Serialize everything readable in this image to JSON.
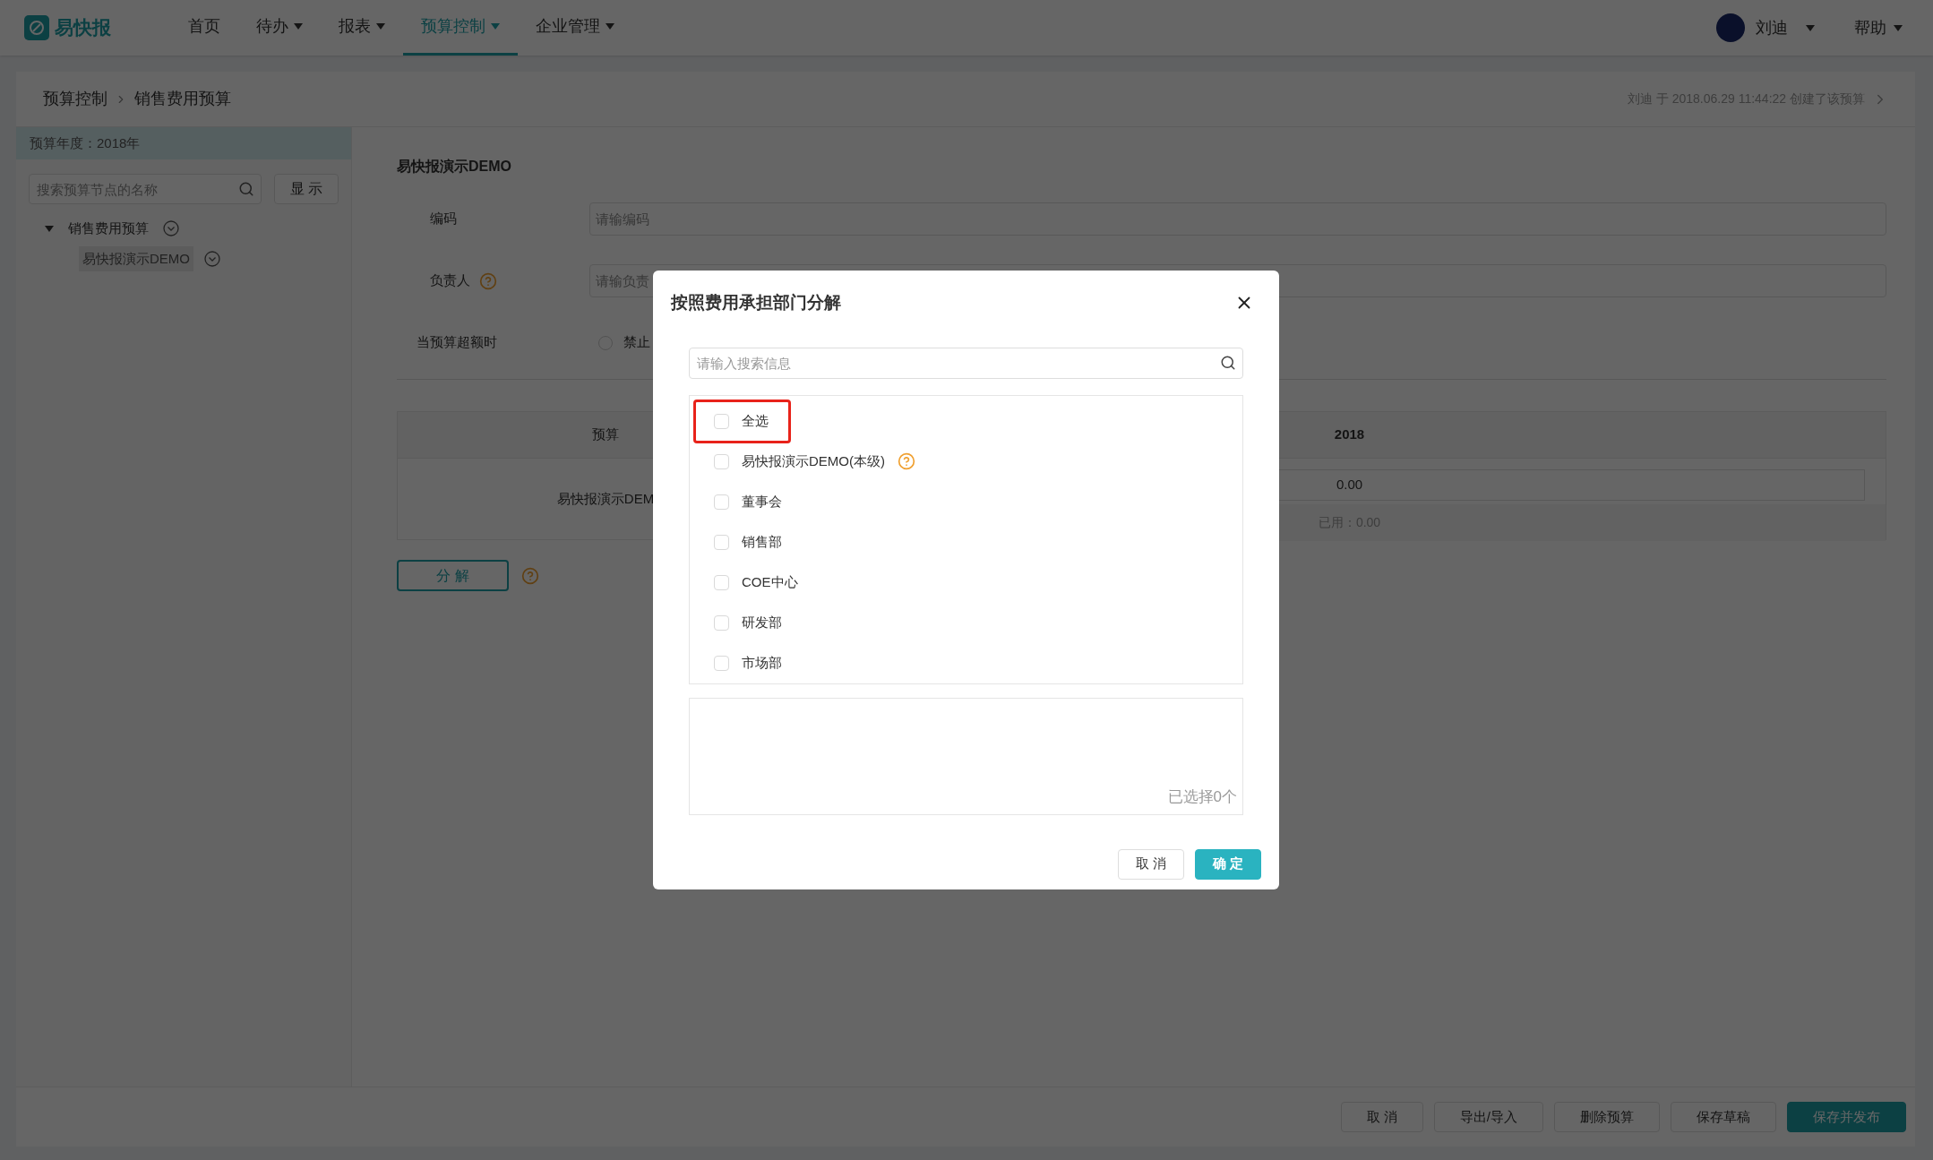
{
  "nav": {
    "logo": "易快报",
    "items": [
      {
        "label": "首页",
        "dropdown": false,
        "selected": false
      },
      {
        "label": "待办",
        "dropdown": true,
        "selected": false
      },
      {
        "label": "报表",
        "dropdown": true,
        "selected": false
      },
      {
        "label": "预算控制",
        "dropdown": true,
        "selected": true
      },
      {
        "label": "企业管理",
        "dropdown": true,
        "selected": false
      }
    ],
    "user": "刘迪",
    "help": "帮助"
  },
  "breadcrumb": [
    "预算控制",
    "销售费用预算"
  ],
  "created_note": "刘迪 于 2018.06.29 11:44:22 创建了该预算",
  "sidebar": {
    "year_label": "预算年度：2018年",
    "search_placeholder": "搜索预算节点的名称",
    "show_button": "显 示",
    "tree": [
      {
        "label": "销售费用预算",
        "expanded": true,
        "selected": false,
        "children": [
          {
            "label": "易快报演示DEMO",
            "selected": true
          }
        ]
      }
    ]
  },
  "form": {
    "title": "易快报演示DEMO",
    "fields": [
      {
        "kind": "input",
        "label": "编码",
        "placeholder": "请输编码",
        "help": false
      },
      {
        "kind": "input",
        "label": "负责人",
        "placeholder": "请输负责",
        "help": true
      },
      {
        "kind": "radio",
        "label": "当预算超额时",
        "option": "禁止",
        "checked": false
      }
    ]
  },
  "table": {
    "columns": [
      "预算",
      "2018"
    ],
    "rows": [
      {
        "name": "易快报演示DEM",
        "value": "0.00",
        "used": "已用：0.00"
      }
    ]
  },
  "split_button": "分 解",
  "footer_buttons": [
    {
      "label": "取 消",
      "primary": false
    },
    {
      "label": "导出/导入",
      "primary": false
    },
    {
      "label": "删除预算",
      "primary": false
    },
    {
      "label": "保存草稿",
      "primary": false
    },
    {
      "label": "保存并发布",
      "primary": true
    }
  ],
  "dialog": {
    "title": "按照费用承担部门分解",
    "search_placeholder": "请输入搜索信息",
    "options": [
      {
        "label": "全选",
        "checked": false,
        "highlighted": true,
        "help": false
      },
      {
        "label": "易快报演示DEMO(本级)",
        "checked": false,
        "highlighted": false,
        "help": true
      },
      {
        "label": "董事会",
        "checked": false,
        "highlighted": false,
        "help": false
      },
      {
        "label": "销售部",
        "checked": false,
        "highlighted": false,
        "help": false
      },
      {
        "label": "COE中心",
        "checked": false,
        "highlighted": false,
        "help": false
      },
      {
        "label": "研发部",
        "checked": false,
        "highlighted": false,
        "help": false
      },
      {
        "label": "市场部",
        "checked": false,
        "highlighted": false,
        "help": false
      }
    ],
    "selected_count": "已选择0个",
    "buttons": [
      {
        "label": "取 消",
        "primary": false
      },
      {
        "label": "确 定",
        "primary": true
      }
    ]
  }
}
